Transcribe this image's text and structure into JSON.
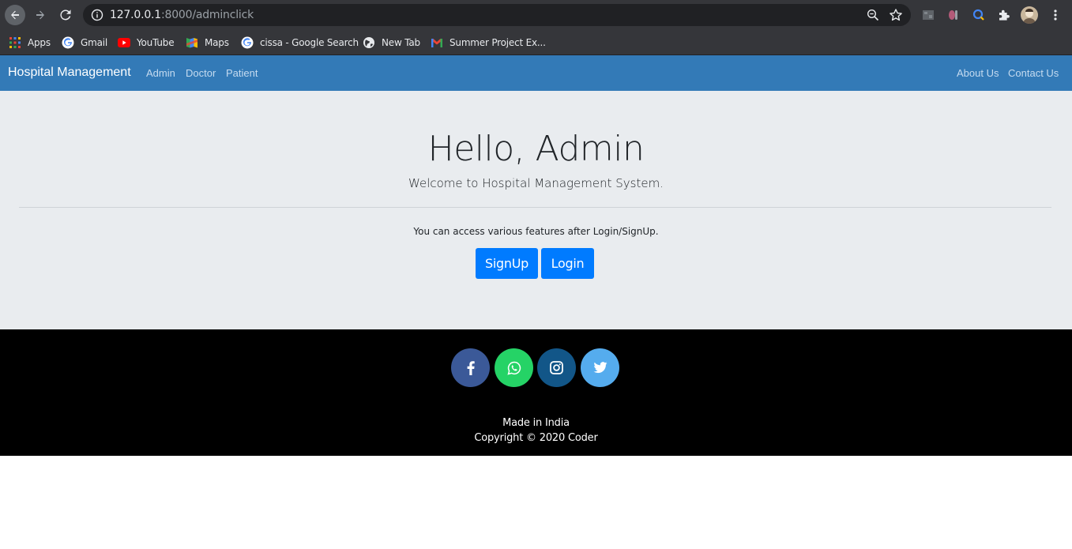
{
  "browser": {
    "url_host": "127.0.0.1",
    "url_path": ":8000/adminclick",
    "bookmarks": [
      {
        "label": "Apps",
        "icon": "apps-grid-icon"
      },
      {
        "label": "Gmail",
        "icon": "google-icon"
      },
      {
        "label": "YouTube",
        "icon": "youtube-icon"
      },
      {
        "label": "Maps",
        "icon": "maps-icon"
      },
      {
        "label": "cissa - Google Search",
        "icon": "google-icon"
      },
      {
        "label": "New Tab",
        "icon": "globe-icon"
      },
      {
        "label": "Summer Project Ex...",
        "icon": "gmail-icon"
      }
    ]
  },
  "navbar": {
    "brand": "Hospital Management",
    "left_links": [
      "Admin",
      "Doctor",
      "Patient"
    ],
    "right_links": [
      "About Us",
      "Contact Us"
    ],
    "color": "#337ab7"
  },
  "jumbotron": {
    "heading": "Hello, Admin",
    "lead": "Welcome to Hospital Management System.",
    "message": "You can access various features after Login/SignUp.",
    "signup_label": "SignUp",
    "login_label": "Login",
    "button_color": "#007bff"
  },
  "footer": {
    "social": [
      {
        "icon": "facebook-icon",
        "color": "#3b5998"
      },
      {
        "icon": "whatsapp-icon",
        "color": "#25d366"
      },
      {
        "icon": "instagram-icon",
        "color": "#125688"
      },
      {
        "icon": "twitter-icon",
        "color": "#55acee"
      }
    ],
    "made_in": "Made in India",
    "copyright": "Copyright © 2020 Coder"
  }
}
